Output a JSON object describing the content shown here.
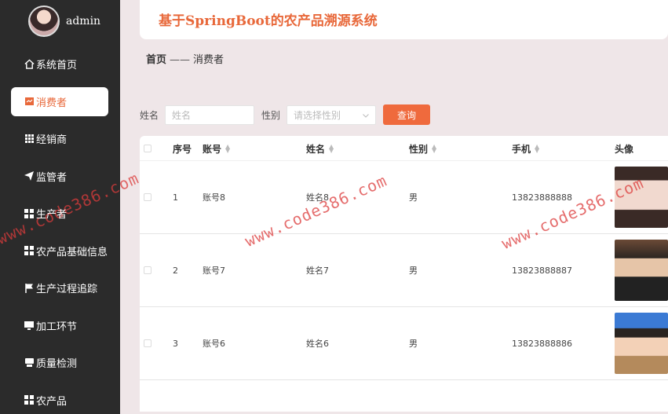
{
  "user": {
    "name": "admin"
  },
  "sidebar": {
    "items": [
      {
        "label": "系统首页",
        "icon": "home-icon"
      },
      {
        "label": "消费者",
        "icon": "consumer-icon",
        "active": true
      },
      {
        "label": "经销商",
        "icon": "grid-icon"
      },
      {
        "label": "监管者",
        "icon": "send-icon"
      },
      {
        "label": "生产者",
        "icon": "grid-icon"
      },
      {
        "label": "农产品基础信息",
        "icon": "grid-icon"
      },
      {
        "label": "生产过程追踪",
        "icon": "flag-icon"
      },
      {
        "label": "加工环节",
        "icon": "monitor-icon"
      },
      {
        "label": "质量检测",
        "icon": "print-icon"
      },
      {
        "label": "农产品",
        "icon": "grid-icon"
      }
    ]
  },
  "header": {
    "title": "基于SpringBoot的农产品溯源系统"
  },
  "breadcrumb": {
    "home": "首页",
    "sep": "——",
    "current": "消费者"
  },
  "search": {
    "name_label": "姓名",
    "name_placeholder": "姓名",
    "gender_label": "性别",
    "gender_placeholder": "请选择性别",
    "query_button": "查询"
  },
  "table": {
    "headers": {
      "index": "序号",
      "account": "账号",
      "name": "姓名",
      "gender": "性别",
      "phone": "手机",
      "avatar": "头像"
    },
    "rows": [
      {
        "index": "1",
        "account": "账号8",
        "name": "姓名8",
        "gender": "男",
        "phone": "13823888888"
      },
      {
        "index": "2",
        "account": "账号7",
        "name": "姓名7",
        "gender": "男",
        "phone": "13823888887"
      },
      {
        "index": "3",
        "account": "账号6",
        "name": "姓名6",
        "gender": "男",
        "phone": "13823888886"
      }
    ]
  },
  "watermark": "www.code386.com",
  "colors": {
    "accent": "#ef6a3d",
    "sidebar": "#2b2b2b",
    "background": "#efe6e8"
  }
}
